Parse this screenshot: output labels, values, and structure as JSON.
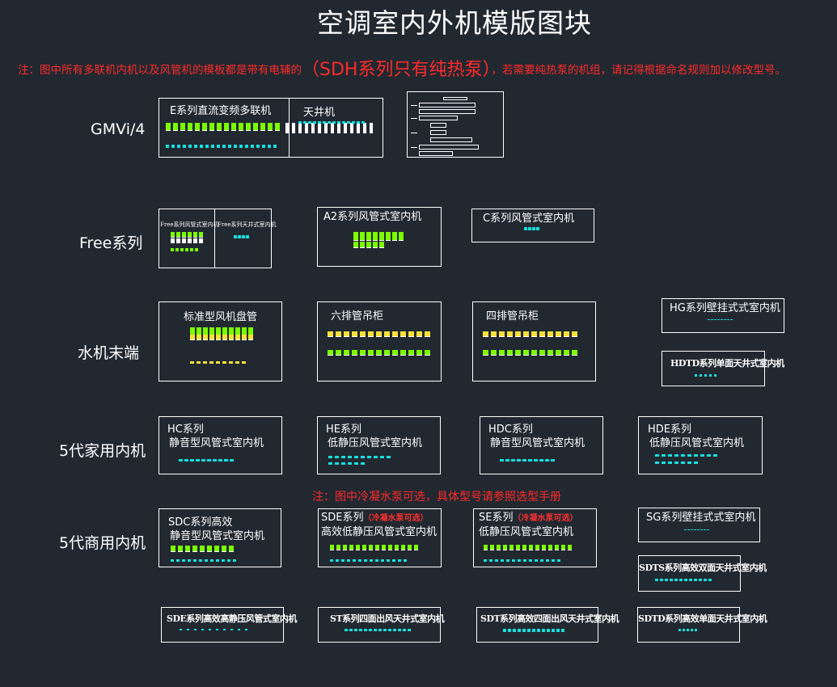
{
  "title": "空调室内外机模版图块",
  "notes": {
    "top_part1": "注：图中所有多联机内机以及风管机的模板都是带有电辅的",
    "top_big": "（SDH系列只有纯热泵）",
    "top_part2": "，若需要纯热泵的机组，请记得根据命名规则加以修改型号。",
    "middle": "注：图中冷凝水泵可选，具体型号请参照选型手册"
  },
  "rows": {
    "gmvi": "GMVi/4",
    "free": "Free系列",
    "water": "水机末端",
    "home5": "5代家用内机",
    "comm5": "5代商用内机"
  },
  "blocks": {
    "e_series": "E系列直流变频多联机",
    "ceiling": "天井机",
    "free_duct": "Free系列风管式室内机",
    "free_ceiling": "Free系列天井式室内机",
    "a2_series": "A2系列风管式室内机",
    "c_series": "C系列风管式室内机",
    "fcu_std": "标准型风机盘管",
    "six_row": "六排管吊柜",
    "four_row": "四排管吊柜",
    "hg_series": "HG系列壁挂式式室内机",
    "hdtd_series": "HDTD系列单面天井式室内机",
    "hc_line1": "HC系列",
    "hc_line2": "静音型风管式室内机",
    "he_line1": "HE系列",
    "he_line2": "低静压风管式室内机",
    "hdc_line1": "HDC系列",
    "hdc_line2": "静音型风管式室内机",
    "hde_line1": "HDE系列",
    "hde_line2": "低静压风管式室内机",
    "sdc_line1": "SDC系列高效",
    "sdc_line2": "静音型风管式室内机",
    "sde_line1": "SDE系列",
    "sde_pump": "（冷凝水泵可选）",
    "sde_line2": "高效低静压风管式室内机",
    "se_line1": "SE系列",
    "se_pump": "（冷凝水泵可选）",
    "se_line2": "低静压风管式室内机",
    "sg_series": "SG系列壁挂式式室内机",
    "sdts_series": "SDTS系列高效双面天井式室内机",
    "sdf_series": "SDE系列高效高静压风管式室内机",
    "st_series": "ST系列四面出风天井式室内机",
    "sdt_series": "SDT系列高效四面出风天井式室内机",
    "sdtd_series": "SDTD系列高效单面天井式室内机"
  },
  "colors": {
    "background": "#212830",
    "note_red": "#ff2a2a",
    "icon_green": "#7CFC00",
    "icon_yellow": "#f5e03a",
    "icon_cyan": "#17e0e0",
    "icon_white": "#ffffff"
  }
}
